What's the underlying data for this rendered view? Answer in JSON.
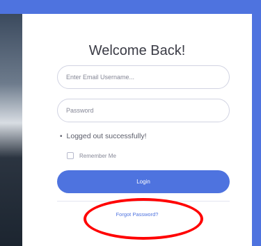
{
  "title": "Welcome Back!",
  "email_field": {
    "placeholder": "Enter Email Username..."
  },
  "password_field": {
    "placeholder": "Password"
  },
  "status_message": "Logged out successfully!",
  "remember": {
    "label": "Remember Me"
  },
  "login_button": {
    "label": "Login"
  },
  "forgot_link": {
    "label": "Forgot Password?"
  },
  "colors": {
    "accent": "#4e73df",
    "annotation": "#ff0000",
    "text_dark": "#3a3b45",
    "border": "#d1d3e2"
  }
}
